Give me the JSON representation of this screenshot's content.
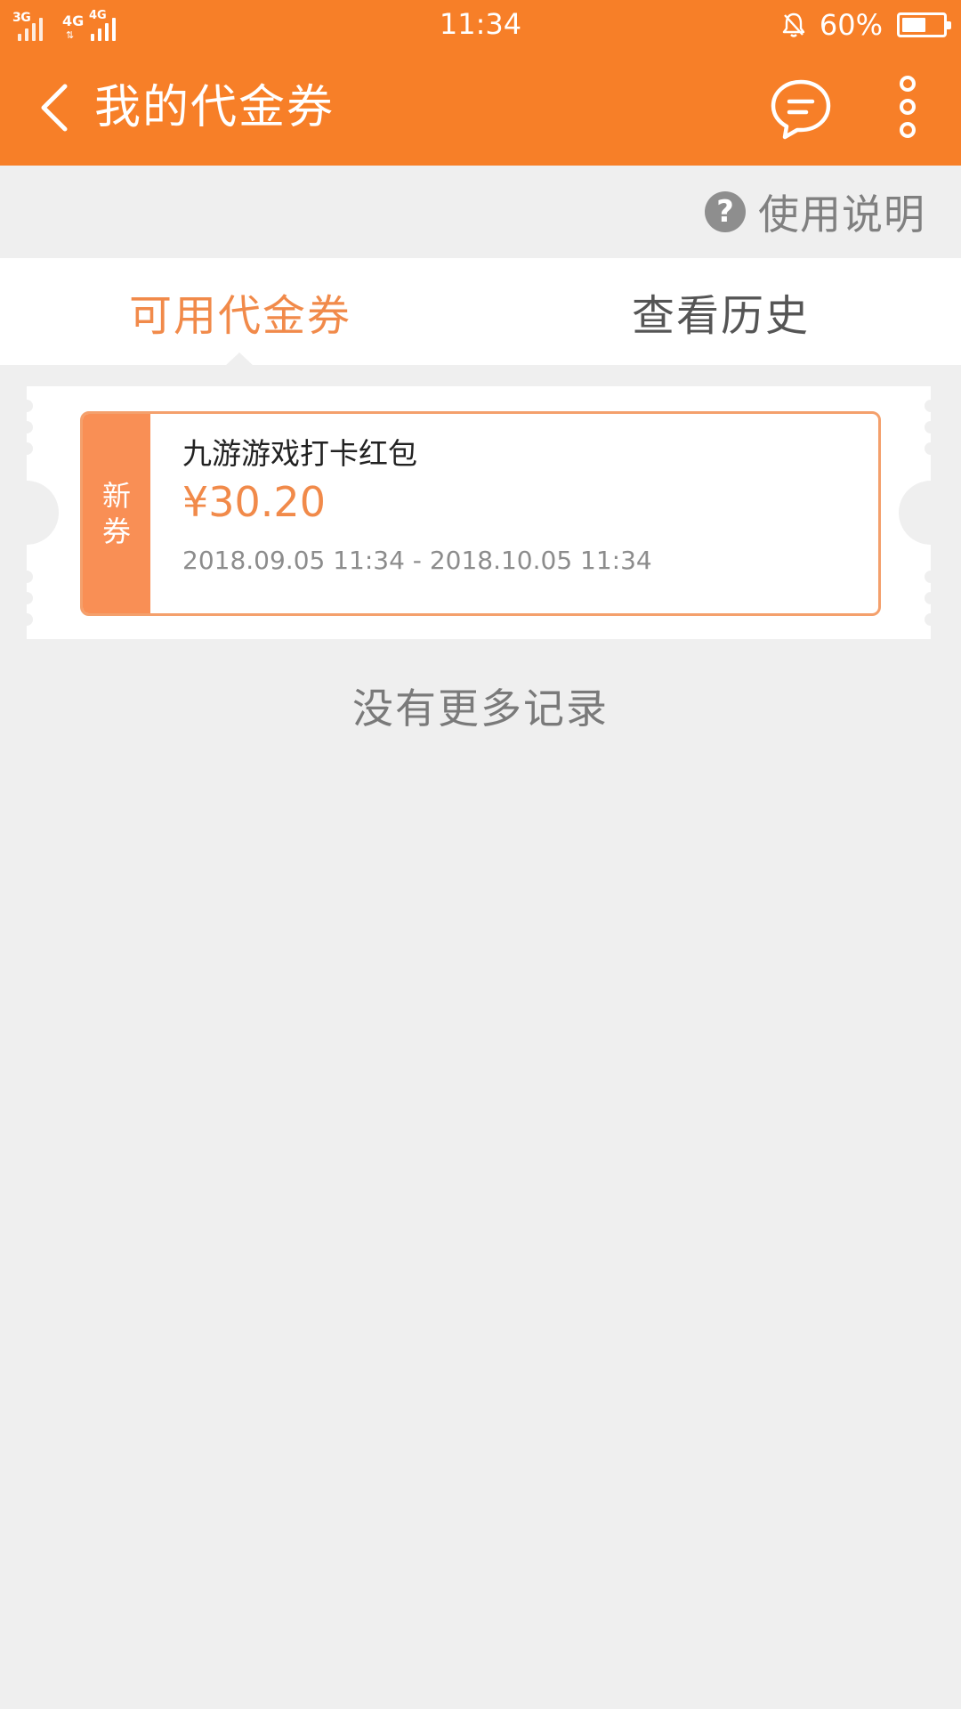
{
  "status_bar": {
    "sim1_label": "3G",
    "sim2_label": "4G",
    "sim2_label_b": "4G",
    "time": "11:34",
    "battery_percent_text": "60%",
    "battery_level": 0.6,
    "icons": [
      "signal-3g-icon",
      "signal-4g-icon",
      "alarm-off-icon",
      "battery-icon"
    ]
  },
  "app_bar": {
    "title": "我的代金券",
    "icons": [
      "back-arrow-icon",
      "message-icon",
      "more-vertical-icon"
    ]
  },
  "help": {
    "label": "使用说明",
    "icon_glyph": "?"
  },
  "tabs": [
    {
      "label": "可用代金券",
      "active": true
    },
    {
      "label": "查看历史",
      "active": false
    }
  ],
  "coupon": {
    "badge": [
      "新",
      "券"
    ],
    "name": "九游游戏打卡红包",
    "amount": "¥30.20",
    "validity": "2018.09.05 11:34 - 2018.10.05 11:34"
  },
  "footer_message": "没有更多记录",
  "colors": {
    "primary": "#f77f28",
    "accent_text": "#f18a4a",
    "badge": "#f98f55",
    "background": "#efefef"
  }
}
